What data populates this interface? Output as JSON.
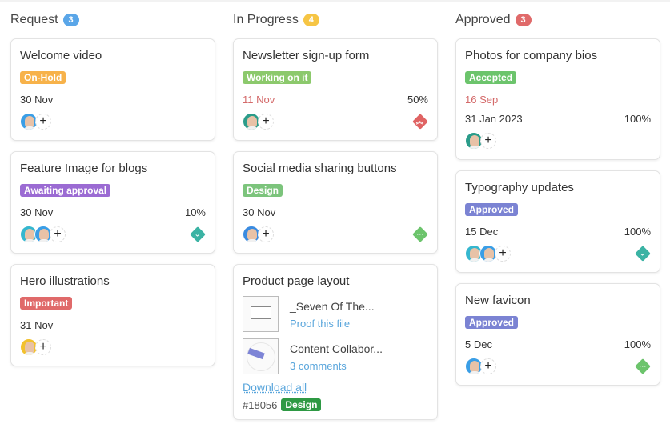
{
  "columns": [
    {
      "title": "Request",
      "count": "3",
      "count_color": "#5aa6e8",
      "cards": [
        {
          "title": "Welcome video",
          "tag": "On-Hold",
          "tag_color": "#f7b24a",
          "date": "30 Nov",
          "progress": "",
          "avatars": [
            {
              "bg": "#3a9ee6"
            }
          ],
          "priority": ""
        },
        {
          "title": "Feature Image for blogs",
          "tag": "Awaiting approval",
          "tag_color": "#9b6bd3",
          "date": "30 Nov",
          "progress": "10%",
          "avatars": [
            {
              "bg": "#35b7cf"
            },
            {
              "bg": "#3a9ee6"
            }
          ],
          "priority": "low",
          "priority_color": "#3bb3a4",
          "priority_glyph": "⌄"
        },
        {
          "title": "Hero illustrations",
          "tag": "Important",
          "tag_color": "#e06a6a",
          "date": "31 Nov",
          "progress": "",
          "avatars": [
            {
              "bg": "#f2c12e"
            }
          ],
          "priority": ""
        }
      ]
    },
    {
      "title": "In Progress",
      "count": "4",
      "count_color": "#f6c544",
      "cards": [
        {
          "title": "Newsletter sign-up form",
          "tag": "Working on it",
          "tag_color": "#8cc96c",
          "date": "11 Nov",
          "date_red": true,
          "progress": "50%",
          "avatars": [
            {
              "bg": "#2b9c8a"
            }
          ],
          "priority": "high",
          "priority_color": "#e06363",
          "priority_glyph": "︽"
        },
        {
          "title": "Social media sharing buttons",
          "tag": "Design",
          "tag_color": "#7cc47c",
          "date": "30 Nov",
          "progress": "",
          "avatars": [
            {
              "bg": "#3a8be0"
            }
          ],
          "priority": "medium",
          "priority_color": "#6cc46c",
          "priority_glyph": "···"
        }
      ],
      "file_card": {
        "title": "Product page layout",
        "files": [
          {
            "name": "_Seven Of The...",
            "link": "Proof this file"
          },
          {
            "name": "Content Collabor...",
            "link": "3 comments"
          }
        ],
        "download_label": "Download all",
        "id": "#18056",
        "tag": "Design"
      }
    },
    {
      "title": "Approved",
      "count": "3",
      "count_color": "#e06a6a",
      "cards": [
        {
          "title": "Photos for company bios",
          "tag": "Accepted",
          "tag_color": "#6cc46c",
          "start_date": "16 Sep",
          "date": "31 Jan 2023",
          "progress": "100%",
          "avatars": [
            {
              "bg": "#2b9c8a"
            }
          ],
          "priority": ""
        },
        {
          "title": "Typography updates",
          "tag": "Approved",
          "tag_color": "#7b83d3",
          "date": "15 Dec",
          "progress": "100%",
          "avatars": [
            {
              "bg": "#35b7cf"
            },
            {
              "bg": "#3a9ee6"
            }
          ],
          "priority": "low",
          "priority_color": "#3bb3a4",
          "priority_glyph": "⌄"
        },
        {
          "title": "New favicon",
          "tag": "Approved",
          "tag_color": "#7b83d3",
          "date": "5 Dec",
          "progress": "100%",
          "avatars": [
            {
              "bg": "#3a9ee6"
            }
          ],
          "priority": "medium",
          "priority_color": "#6cc46c",
          "priority_glyph": "···"
        }
      ]
    }
  ],
  "add_assignee_glyph": "+"
}
